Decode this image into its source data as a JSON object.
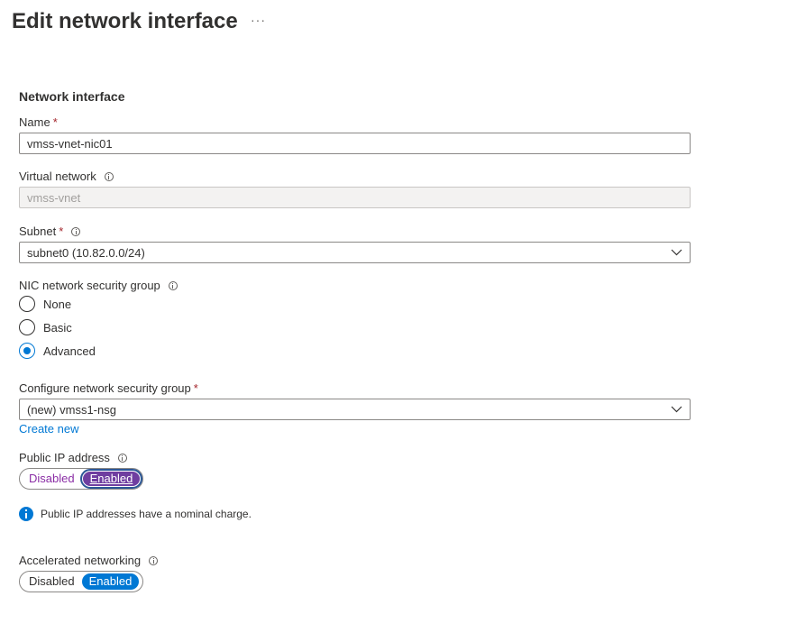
{
  "header": {
    "title": "Edit network interface",
    "more_actions": "···"
  },
  "section": {
    "title": "Network interface"
  },
  "name": {
    "label": "Name",
    "required": "*",
    "value": "vmss-vnet-nic01"
  },
  "virtual_network": {
    "label": "Virtual network",
    "value": "vmss-vnet"
  },
  "subnet": {
    "label": "Subnet",
    "required": "*",
    "selected": "subnet0 (10.82.0.0/24)"
  },
  "nsg": {
    "label": "NIC network security group",
    "options": [
      {
        "label": "None",
        "checked": false
      },
      {
        "label": "Basic",
        "checked": false
      },
      {
        "label": "Advanced",
        "checked": true
      }
    ]
  },
  "configure_nsg": {
    "label": "Configure network security group",
    "required": "*",
    "selected": "(new) vmss1-nsg",
    "create_new": "Create new"
  },
  "public_ip": {
    "label": "Public IP address",
    "disabled_label": "Disabled",
    "enabled_label": "Enabled",
    "selected": "Enabled",
    "notice": "Public IP addresses have a nominal charge."
  },
  "accelerated": {
    "label": "Accelerated networking",
    "disabled_label": "Disabled",
    "enabled_label": "Enabled",
    "selected": "Enabled"
  },
  "colors": {
    "accent": "#0078d4",
    "required": "#a4262c",
    "toggle_purple": "#6f3ea0"
  },
  "icons": [
    "info-icon",
    "chevron-down-icon",
    "more-icon"
  ]
}
